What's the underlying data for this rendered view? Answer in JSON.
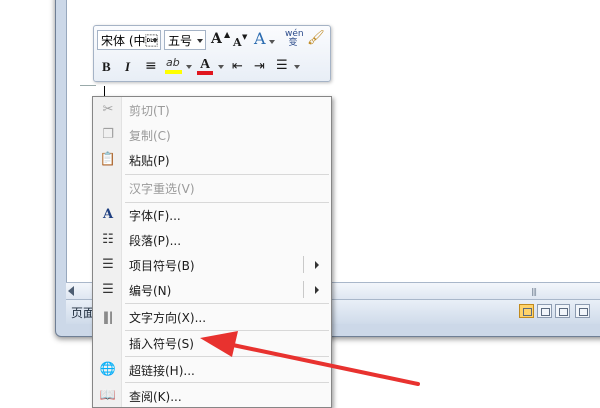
{
  "mini_toolbar": {
    "font_name": "宋体 (中\u0001",
    "font_size": "五号",
    "grow_font": "A",
    "shrink_font": "A",
    "styles": "A",
    "phonetic": "wén\n変",
    "bold": "B",
    "italic": "I",
    "center": "≡",
    "highlight": "ab",
    "font_color": "A"
  },
  "context_menu": {
    "items": [
      {
        "label": "剪切(T)",
        "disabled": true,
        "icon": "scissors-icon"
      },
      {
        "label": "复制(C)",
        "disabled": true,
        "icon": "copy-icon"
      },
      {
        "label": "粘贴(P)",
        "disabled": false,
        "icon": "paste-icon"
      },
      {
        "label": "汉字重选(V)",
        "disabled": true,
        "icon": ""
      },
      {
        "label": "字体(F)...",
        "disabled": false,
        "icon": "font-icon"
      },
      {
        "label": "段落(P)...",
        "disabled": false,
        "icon": "paragraph-icon"
      },
      {
        "label": "项目符号(B)",
        "disabled": false,
        "icon": "bullets-icon",
        "submenu": true
      },
      {
        "label": "编号(N)",
        "disabled": false,
        "icon": "numbering-icon",
        "submenu": true
      },
      {
        "label": "文字方向(X)...",
        "disabled": false,
        "icon": "text-direction-icon"
      },
      {
        "label": "插入符号(S)",
        "disabled": false,
        "icon": ""
      },
      {
        "label": "超链接(H)...",
        "disabled": false,
        "icon": "hyperlink-icon"
      },
      {
        "label": "查阅(K)...",
        "disabled": false,
        "icon": "lookup-icon"
      }
    ]
  },
  "status_bar": {
    "page_label": "页面"
  },
  "colors": {
    "highlight": "#ffff00",
    "font_color": "#e0161e",
    "annotation_arrow": "#e8322f"
  }
}
